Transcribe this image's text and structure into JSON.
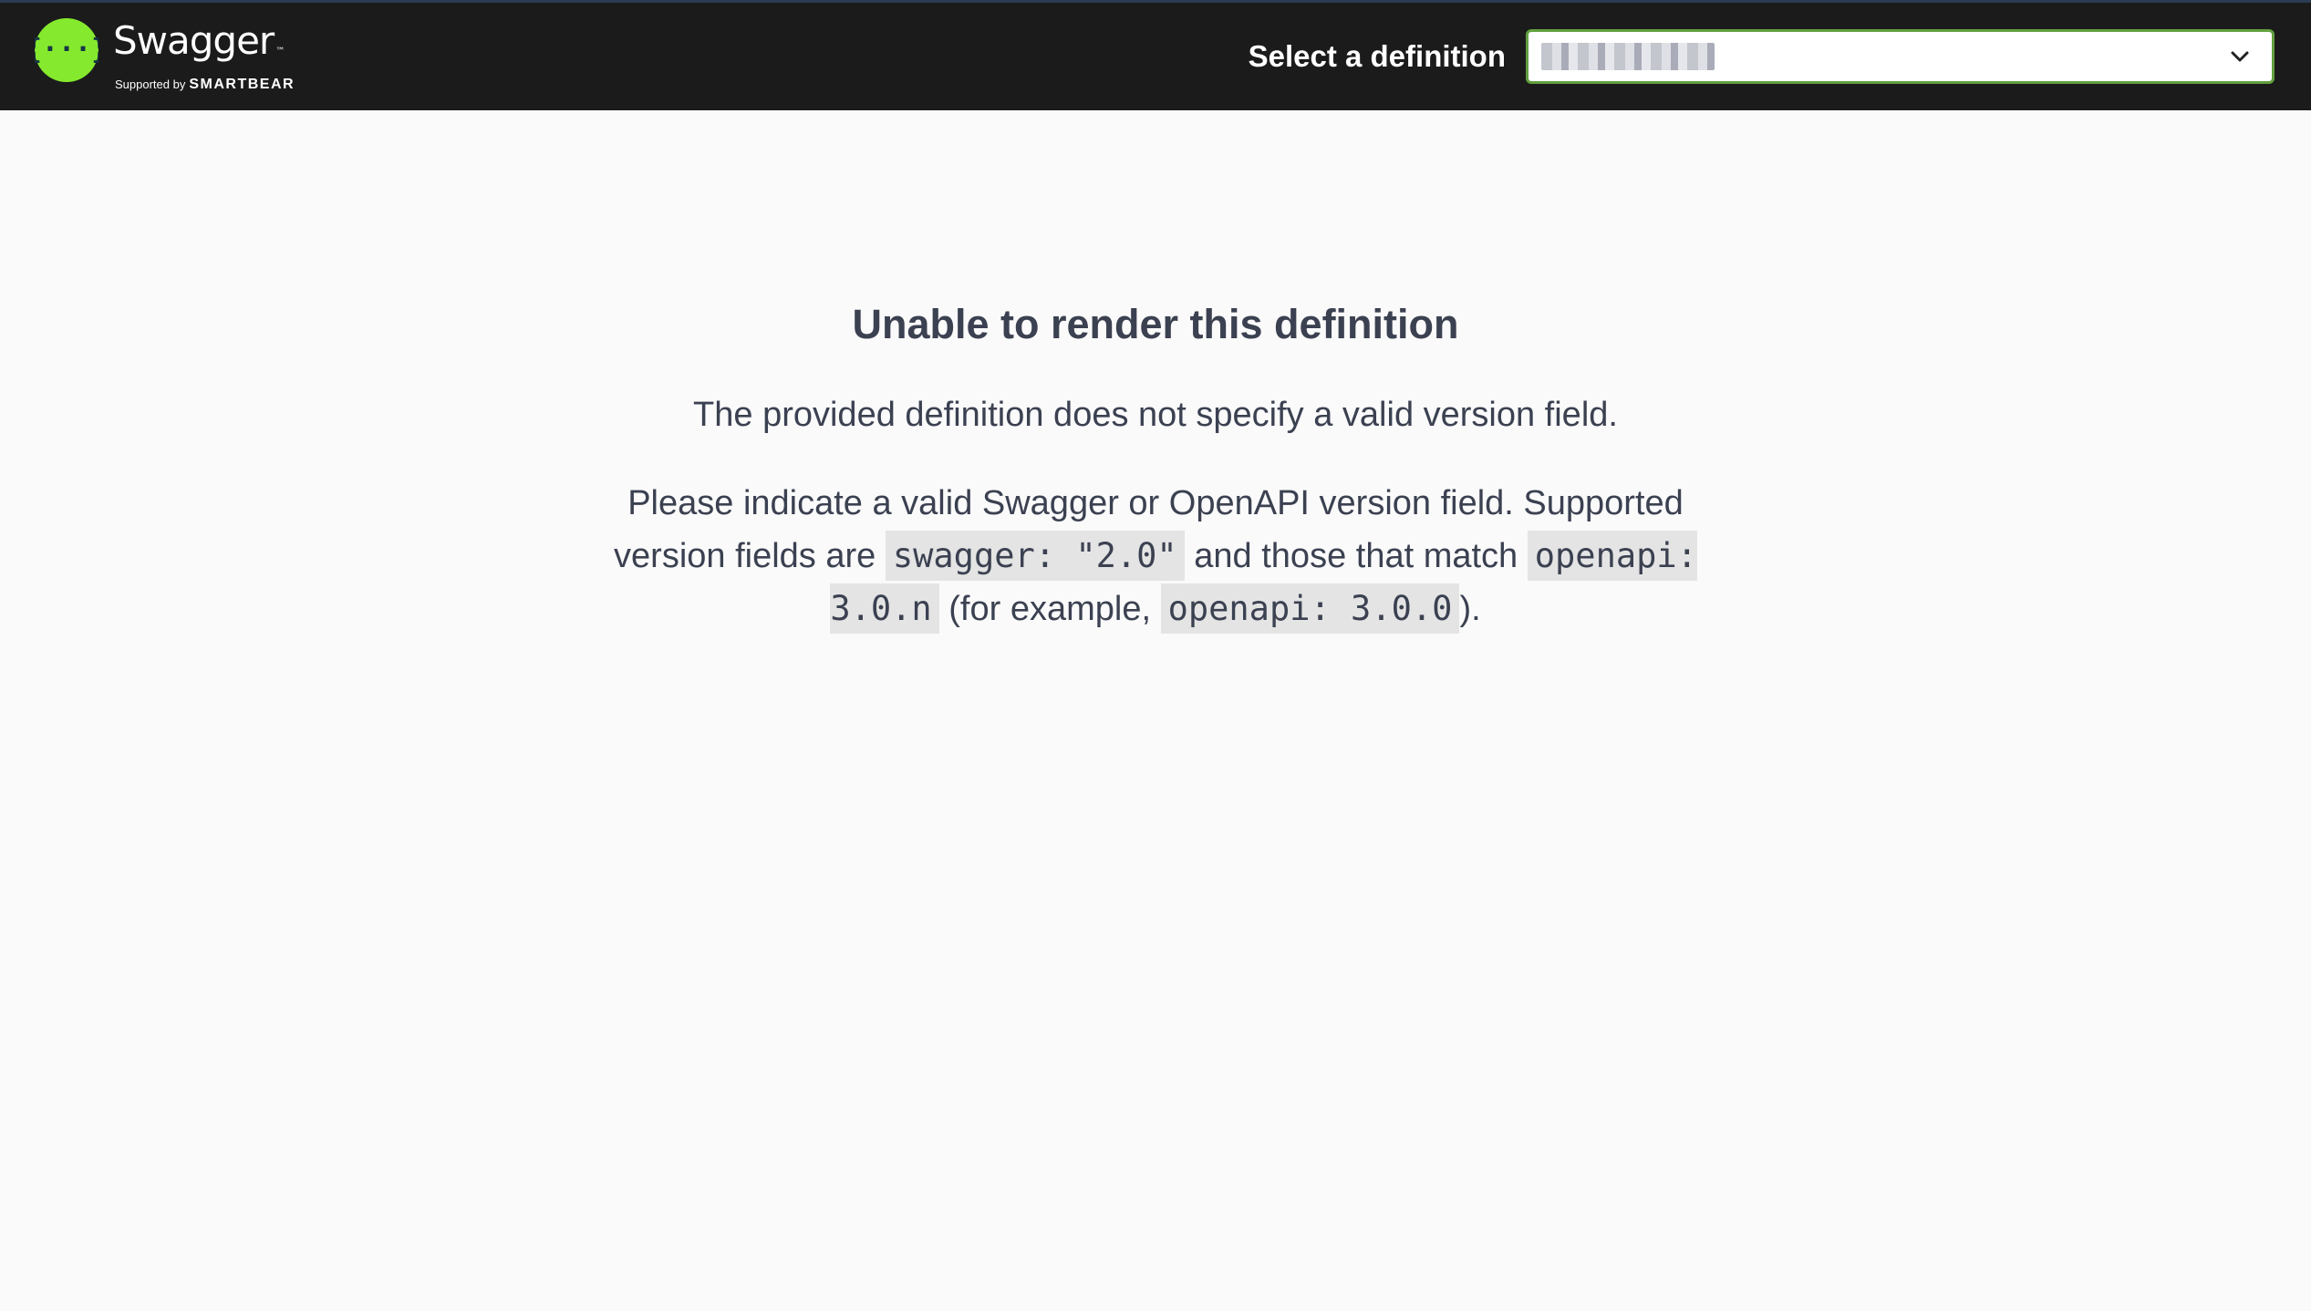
{
  "header": {
    "logo_name": "Swagger",
    "logo_tm": "™",
    "logo_supported_by": "Supported by",
    "logo_brand": "SMARTBEAR",
    "selector_label": "Select a definition",
    "colors": {
      "topbar_bg": "#1b1b1b",
      "brand_green": "#85ea2d",
      "select_border": "#62a03f"
    }
  },
  "error": {
    "title": "Unable to render this definition",
    "message": "The provided definition does not specify a valid version field.",
    "detail_part1": "Please indicate a valid Swagger or OpenAPI version field. Supported version fields are",
    "code_swagger": "swagger: \"2.0\"",
    "detail_part2": "and those that match",
    "code_openapi_pattern": "openapi: 3.0.n",
    "detail_part3": "(for example,",
    "code_openapi_example": "openapi: 3.0.0",
    "detail_part4": ")."
  },
  "icons": {
    "logo": "swagger-braces-icon",
    "dropdown": "chevron-down-icon"
  }
}
